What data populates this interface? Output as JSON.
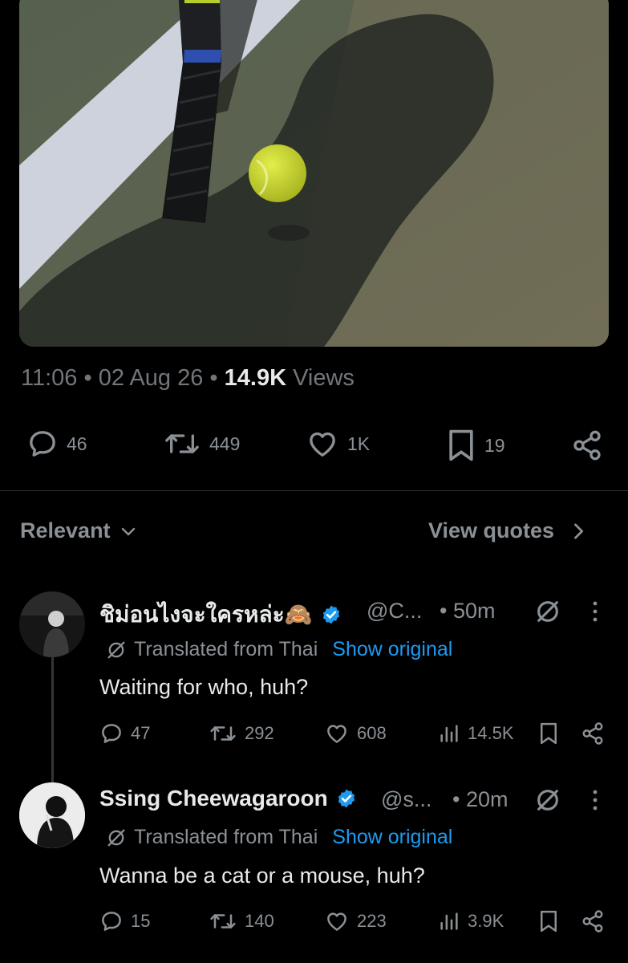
{
  "post": {
    "media_alt": "tennis racket and ball on court",
    "time": "11:06",
    "date": "02 Aug 26",
    "views_count": "14.9K",
    "views_label": "Views",
    "sep": "•"
  },
  "actions": {
    "replies": "46",
    "reposts": "449",
    "likes": "1K",
    "bookmarks": "19"
  },
  "sort": {
    "label": "Relevant",
    "view_quotes": "View quotes"
  },
  "replies": [
    {
      "name": "ชิม่อนไงจะใครหล่ะ🙈",
      "handle": "@C...",
      "time": "• 50m",
      "translated": "Translated from Thai",
      "show_original": "Show original",
      "text": "Waiting for who, huh?",
      "reply_count": "47",
      "repost_count": "292",
      "like_count": "608",
      "view_count": "14.5K"
    },
    {
      "name": "Ssing Cheewagaroon",
      "handle": "@s...",
      "time": "• 20m",
      "translated": "Translated from Thai",
      "show_original": "Show original",
      "text": "Wanna be a cat or a mouse, huh?",
      "reply_count": "15",
      "repost_count": "140",
      "like_count": "223",
      "view_count": "3.9K"
    }
  ],
  "colors": {
    "accent": "#1d9bf0",
    "muted": "#71767b",
    "text": "#e7e9ea",
    "background": "#000000"
  }
}
